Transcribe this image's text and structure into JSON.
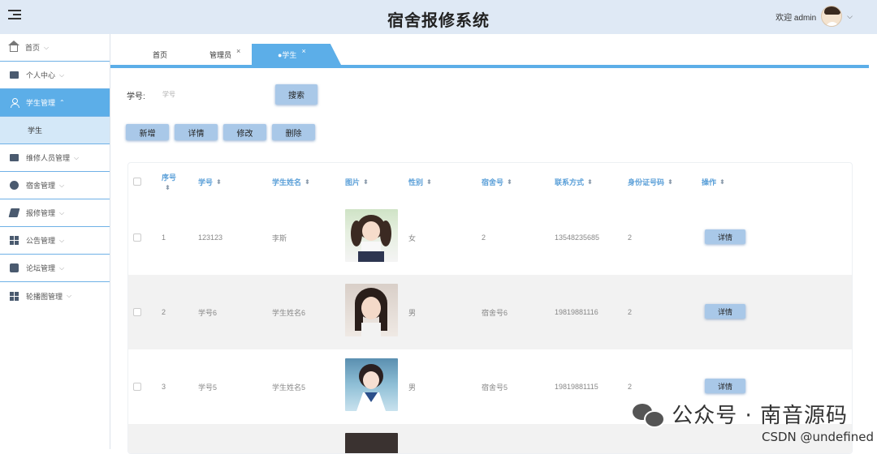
{
  "header": {
    "title": "宿舍报修系统",
    "welcome": "欢迎 admin"
  },
  "sidebar": {
    "items": [
      {
        "label": "首页",
        "icon": "home-icon"
      },
      {
        "label": "个人中心",
        "icon": "folder-icon"
      },
      {
        "label": "学生管理",
        "icon": "user-icon",
        "active": true
      },
      {
        "sub_label": "学生"
      },
      {
        "label": "维修人员管理",
        "icon": "ticket-icon"
      },
      {
        "label": "宿舍管理",
        "icon": "building-icon"
      },
      {
        "label": "报修管理",
        "icon": "wrench-icon"
      },
      {
        "label": "公告管理",
        "icon": "grid-icon"
      },
      {
        "label": "论坛管理",
        "icon": "forum-icon"
      },
      {
        "label": "轮播图管理",
        "icon": "layout-icon"
      }
    ]
  },
  "tabs": [
    {
      "label": "首页"
    },
    {
      "label": "管理员",
      "close": "×"
    },
    {
      "label": "●学生",
      "close": "×",
      "active": true
    }
  ],
  "search": {
    "label": "学号:",
    "placeholder": "学号",
    "button": "搜索"
  },
  "actions": {
    "add": "新增",
    "detail": "详情",
    "edit": "修改",
    "delete": "删除"
  },
  "table": {
    "headers": {
      "index": "序号",
      "student_no": "学号",
      "student_name": "学生姓名",
      "photo": "图片",
      "gender": "性别",
      "dorm_no": "宿舍号",
      "contact": "联系方式",
      "id_no": "身份证号码",
      "op": "操作"
    },
    "rows": [
      {
        "index": "1",
        "student_no": "123123",
        "student_name": "李斯",
        "gender": "女",
        "dorm_no": "2",
        "contact": "13548235685",
        "id_no": "2",
        "op": "详情"
      },
      {
        "index": "2",
        "student_no": "学号6",
        "student_name": "学生姓名6",
        "gender": "男",
        "dorm_no": "宿舍号6",
        "contact": "19819881116",
        "id_no": "2",
        "op": "详情"
      },
      {
        "index": "3",
        "student_no": "学号5",
        "student_name": "学生姓名5",
        "gender": "男",
        "dorm_no": "宿舍号5",
        "contact": "19819881115",
        "id_no": "2",
        "op": "详情"
      }
    ]
  },
  "watermark": {
    "line1": "公众号 · 南音源码",
    "line2": "CSDN @undefined"
  },
  "colors": {
    "accent": "#5caee8",
    "header_bg": "#dfe9f5",
    "button_bg": "#a9c8e8",
    "header_text": "#5a9fd8"
  }
}
